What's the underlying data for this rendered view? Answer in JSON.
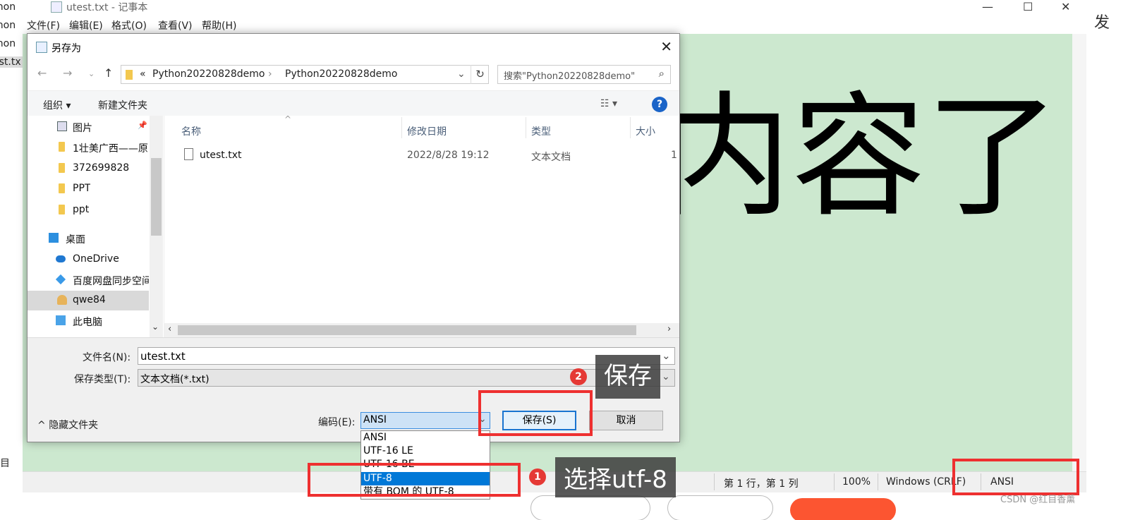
{
  "notepad": {
    "title": "utest.txt - 记事本",
    "menu": [
      "文件(F)",
      "编辑(E)",
      "格式(O)",
      "查看(V)",
      "帮助(H)"
    ],
    "big_text": "内容了",
    "status": {
      "position": "第 1 行，第 1 列",
      "zoom": "100%",
      "line_ending": "Windows (CRLF)",
      "encoding": "ANSI"
    },
    "left_snippets": [
      "ython",
      "ython",
      "ython",
      "est.tx",
      "目"
    ],
    "right_snippet": "发"
  },
  "dialog": {
    "title": "另存为",
    "address_sep": "«",
    "breadcrumb": [
      "Python20220828demo",
      "Python20220828demo"
    ],
    "search_placeholder": "搜索\"Python20220828demo\"",
    "toolbar": {
      "organize": "组织 ▾",
      "new_folder": "新建文件夹"
    },
    "help_label": "?",
    "tree": [
      {
        "label": "图片",
        "icon": "picture-icon"
      },
      {
        "label": "1壮美广西——原",
        "icon": "folder-icon"
      },
      {
        "label": "372699828",
        "icon": "folder-icon"
      },
      {
        "label": "PPT",
        "icon": "folder-icon"
      },
      {
        "label": "ppt",
        "icon": "folder-icon"
      },
      {
        "label": "桌面",
        "icon": "desktop-icon"
      },
      {
        "label": "OneDrive",
        "icon": "cloud-icon"
      },
      {
        "label": "百度网盘同步空间",
        "icon": "baidu-icon"
      },
      {
        "label": "qwe84",
        "icon": "user-icon"
      },
      {
        "label": "此电脑",
        "icon": "computer-icon"
      }
    ],
    "columns": [
      "名称",
      "修改日期",
      "类型",
      "大小"
    ],
    "files": [
      {
        "name": "utest.txt",
        "date": "2022/8/28 19:12",
        "type": "文本文档",
        "size": "1"
      }
    ],
    "filename_label": "文件名(N):",
    "filename_value": "utest.txt",
    "filetype_label": "保存类型(T):",
    "filetype_value": "文本文档(*.txt)",
    "encoding_label": "编码(E):",
    "encoding_value": "ANSI",
    "encoding_options": [
      "ANSI",
      "UTF-16 LE",
      "UTF-16 BE",
      "UTF-8",
      "带有 BOM 的 UTF-8"
    ],
    "encoding_selected_index": 3,
    "save_label": "保存(S)",
    "cancel_label": "取消",
    "hide_folders_label": "隐藏文件夹"
  },
  "annotations": {
    "step1_badge": "1",
    "step1_text": "选择utf-8",
    "step2_badge": "2",
    "step2_text": "保存",
    "highlight_color": "#ee3030"
  },
  "watermark": "CSDN @红目香薰"
}
